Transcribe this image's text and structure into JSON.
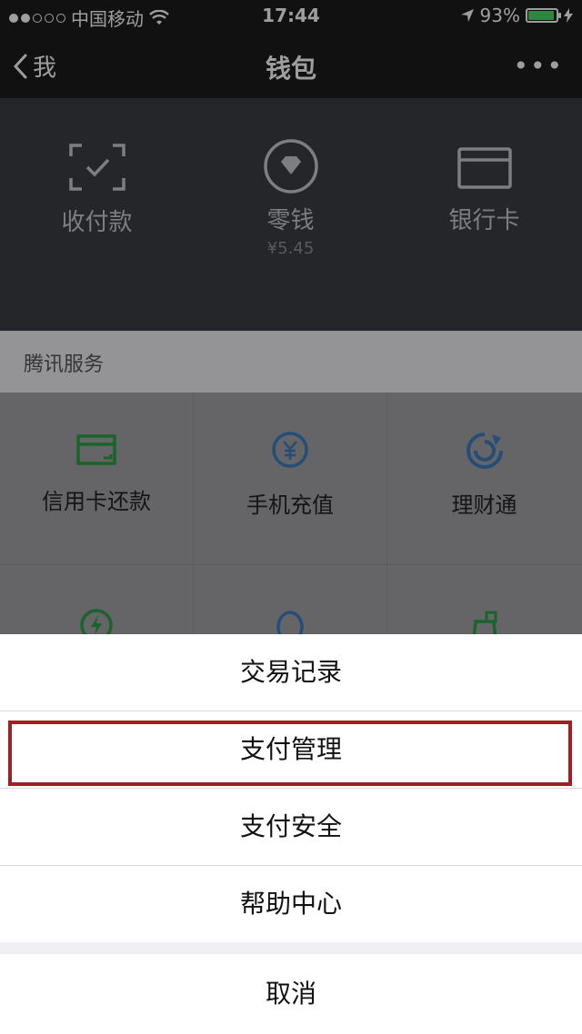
{
  "status_bar": {
    "carrier": "中国移动",
    "time": "17:44",
    "battery": "93%",
    "battery_level": 0.93
  },
  "nav": {
    "back_label": "我",
    "title": "钱包",
    "more_label": "•••"
  },
  "wallet": {
    "items": [
      {
        "label": "收付款",
        "icon": "scan-pay-icon"
      },
      {
        "label": "零钱",
        "sub": "¥5.45",
        "icon": "change-diamond-icon"
      },
      {
        "label": "银行卡",
        "icon": "bank-card-icon"
      }
    ]
  },
  "services": {
    "section_title": "腾讯服务",
    "items": [
      {
        "label": "信用卡还款",
        "icon": "credit-card-icon"
      },
      {
        "label": "手机充值",
        "icon": "yuan-coin-icon"
      },
      {
        "label": "理财通",
        "icon": "wealth-icon"
      }
    ]
  },
  "action_sheet": {
    "items": [
      "交易记录",
      "支付管理",
      "支付安全",
      "帮助中心"
    ],
    "cancel": "取消",
    "highlighted_index": 1
  },
  "colors": {
    "bar": "#1c1c1e",
    "header": "#3b3e44",
    "highlight": "#a61c24",
    "green": "#2aa146",
    "blue": "#3a7fc1",
    "battery": "#4cd964"
  }
}
